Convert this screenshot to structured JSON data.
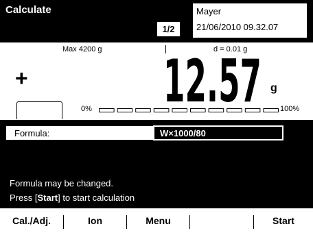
{
  "header": {
    "title": "Calculate",
    "page": "1/2",
    "user": "Mayer",
    "datetime": "21/06/2010 09.32.07"
  },
  "weighing": {
    "max": "Max 4200 g",
    "resolution": "d = 0.01 g",
    "sign": "+",
    "value": "12.57",
    "unit": "g",
    "bargraph": {
      "min_label": "0%",
      "max_label": "100%",
      "segments": 10,
      "fill_fraction": 0.0
    }
  },
  "formula": {
    "label": "Formula:",
    "value": "W×1000/80"
  },
  "messages": {
    "line1": "Formula may be changed.",
    "line2_pre": "Press [",
    "line2_key": "Start",
    "line2_post": "] to start calculation"
  },
  "softkeys": [
    "Cal./Adj.",
    "Ion",
    "Menu",
    "",
    "Start"
  ],
  "colors": {
    "background": "#ffffff",
    "foreground": "#000000"
  }
}
